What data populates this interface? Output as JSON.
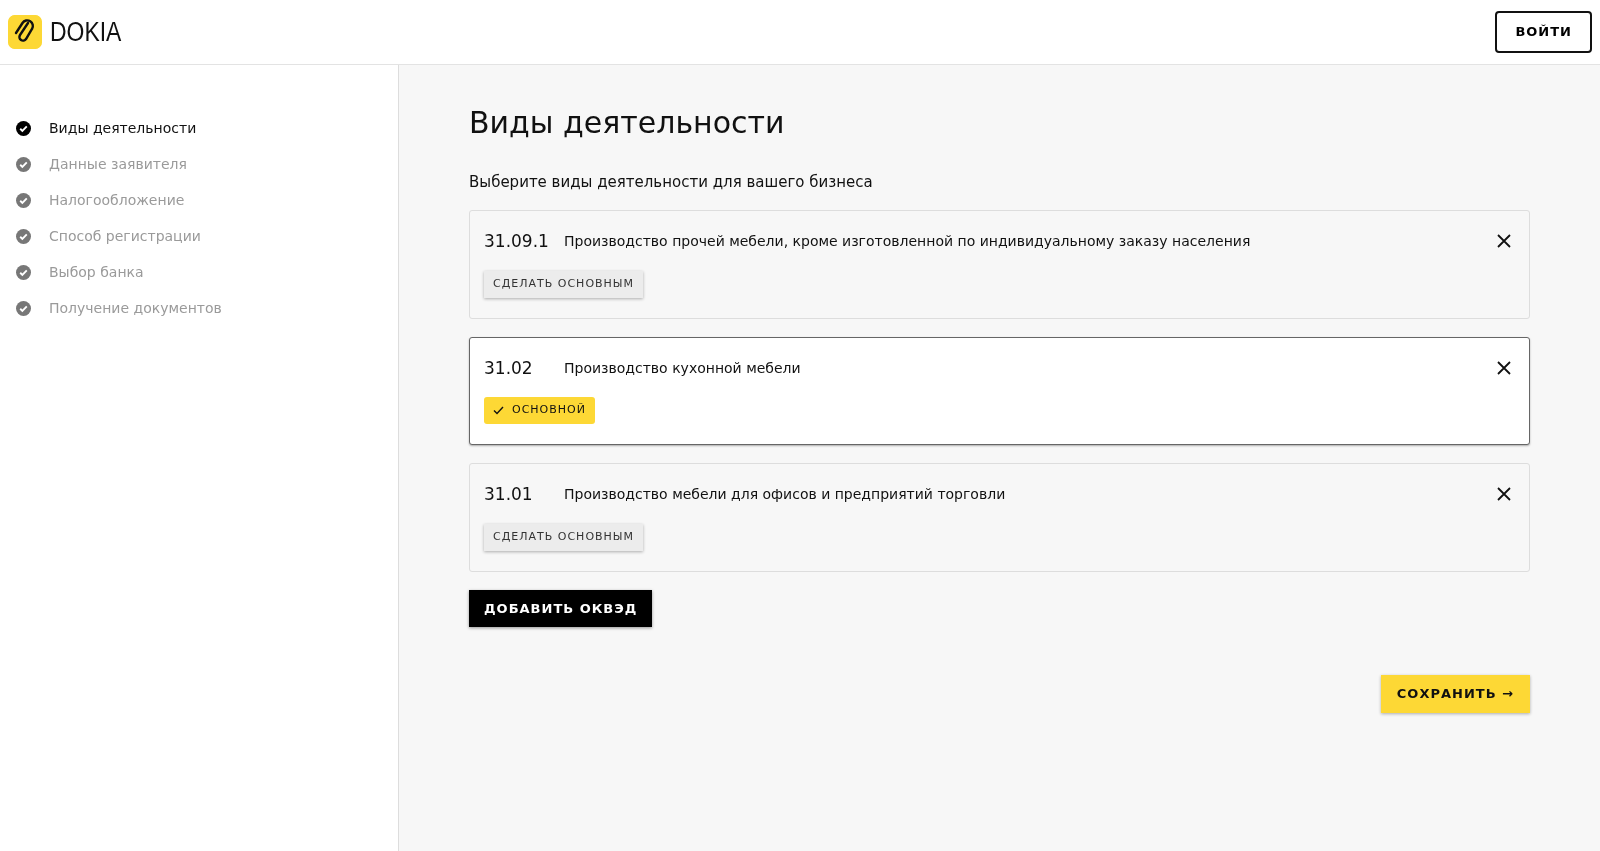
{
  "header": {
    "logo": "DOKIA",
    "login_button": "ВОЙТИ"
  },
  "steps": [
    {
      "label": "Виды деятельности",
      "selected": true
    },
    {
      "label": "Данные заявителя",
      "selected": false
    },
    {
      "label": "Налогообложение",
      "selected": false
    },
    {
      "label": "Способ регистрации",
      "selected": false
    },
    {
      "label": "Выбор банка",
      "selected": false
    },
    {
      "label": "Получение документов",
      "selected": false
    }
  ],
  "page": {
    "title": "Виды деятельности",
    "subtitle": "Выберите виды деятельности для вашего бизнеса"
  },
  "activities": [
    {
      "code": "31.09.1",
      "name": "Производство прочей мебели, кроме изготовленной по индивидуальному заказу населения",
      "primary": false,
      "action": "СДЕЛАТЬ ОСНОВНЫМ"
    },
    {
      "code": "31.02",
      "name": "Производство кухонной мебели",
      "primary": true,
      "action": "ОСНОВНОЙ"
    },
    {
      "code": "31.01",
      "name": "Производство мебели для офисов и предприятий торговли",
      "primary": false,
      "action": "СДЕЛАТЬ ОСНОВНЫМ"
    }
  ],
  "add_button": "ДОБАВИТЬ ОКВЭД",
  "save_button": "СОХРАНИТЬ →"
}
